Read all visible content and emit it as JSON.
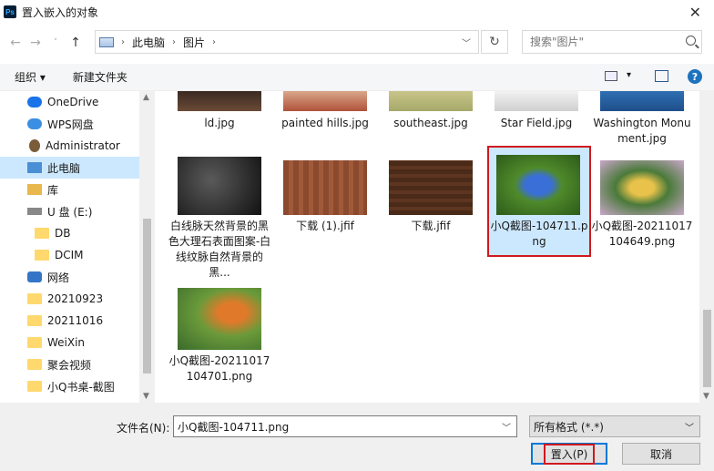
{
  "window": {
    "title": "置入嵌入的对象",
    "app_icon": "ps-icon"
  },
  "nav": {
    "breadcrumb": [
      "此电脑",
      "图片"
    ],
    "search_placeholder": "搜索\"图片\""
  },
  "toolbar": {
    "organize": "组织 ▾",
    "new_folder": "新建文件夹"
  },
  "sidebar": {
    "items": [
      {
        "label": "OneDrive",
        "icon": "onedrive-icon"
      },
      {
        "label": "WPS网盘",
        "icon": "wps-cloud-icon"
      },
      {
        "label": "Administrator",
        "icon": "user-icon"
      },
      {
        "label": "此电脑",
        "icon": "pc-icon",
        "selected": true
      },
      {
        "label": "库",
        "icon": "library-icon"
      },
      {
        "label": "U 盘 (E:)",
        "icon": "drive-icon"
      },
      {
        "label": "DB",
        "icon": "folder-icon"
      },
      {
        "label": "DCIM",
        "icon": "folder-icon"
      },
      {
        "label": "网络",
        "icon": "network-icon"
      },
      {
        "label": "20210923",
        "icon": "folder-icon"
      },
      {
        "label": "20211016",
        "icon": "folder-icon"
      },
      {
        "label": "WeiXin",
        "icon": "folder-icon"
      },
      {
        "label": "聚会视频",
        "icon": "folder-icon"
      },
      {
        "label": "小Q书桌-截图",
        "icon": "folder-icon"
      }
    ]
  },
  "files": [
    {
      "name": "ld.jpg"
    },
    {
      "name": "painted hills.jpg"
    },
    {
      "name": "southeast.jpg"
    },
    {
      "name": "Star Field.jpg"
    },
    {
      "name": "Washington Monument.jpg"
    },
    {
      "name": "白线脉天然背景的黑色大理石表面图案-白线纹脉自然背景的黑..."
    },
    {
      "name": "下载 (1).jfif"
    },
    {
      "name": "下载.jfif"
    },
    {
      "name": "小Q截图-104711.png",
      "selected": true
    },
    {
      "name": "小Q截图-20211017104649.png"
    },
    {
      "name": "小Q截图-20211017104701.png"
    }
  ],
  "bottom": {
    "filename_label": "文件名(N):",
    "filename_value": "小Q截图-104711.png",
    "filetype_value": "所有格式 (*.*)",
    "place_button": "置入(P)",
    "cancel_button": "取消"
  },
  "colors": {
    "selection": "#cce8ff",
    "highlight_box": "#d0191e",
    "accent": "#0078d7"
  }
}
